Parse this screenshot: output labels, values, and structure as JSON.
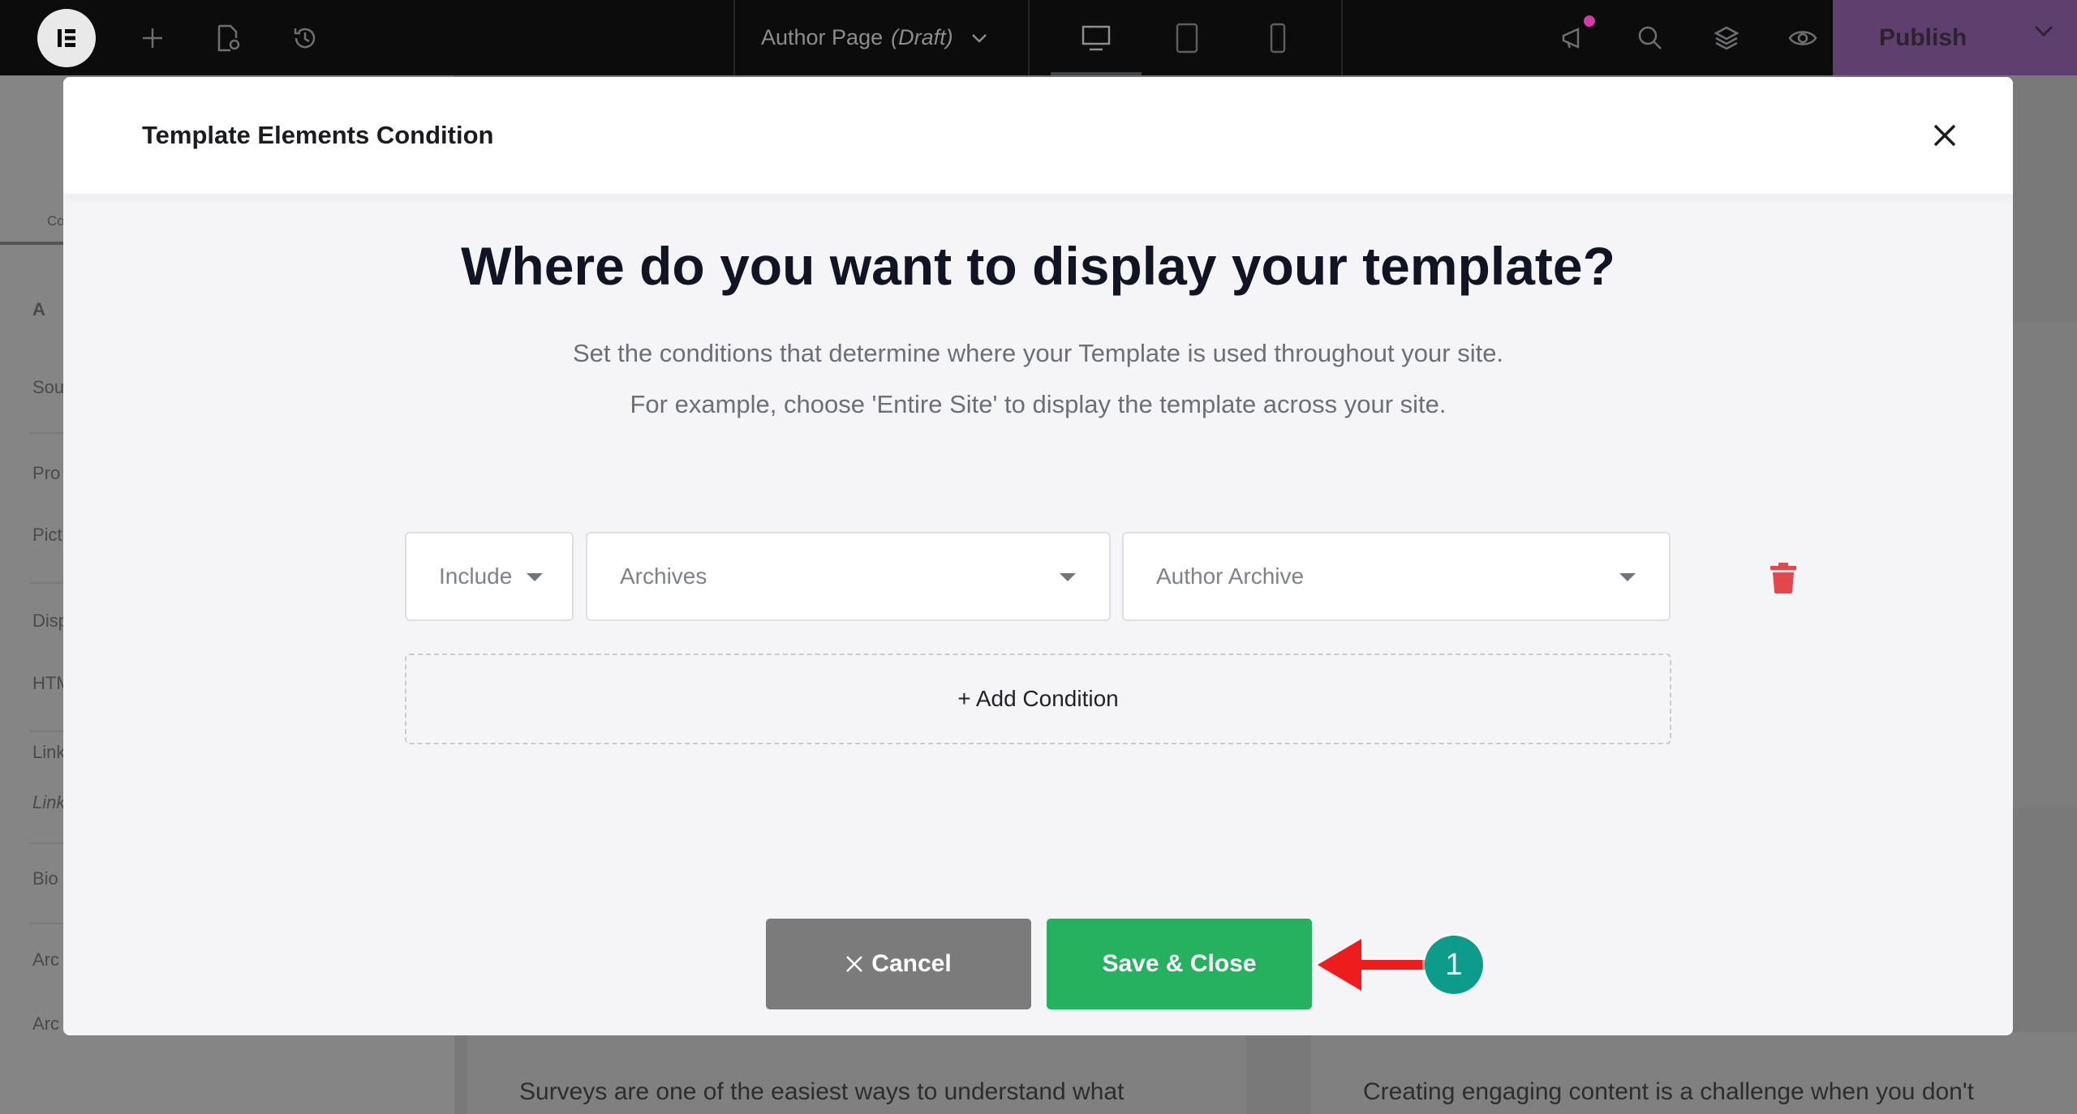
{
  "topbar": {
    "page_title": "Author Page",
    "page_status": "(Draft)",
    "publish_label": "Publish",
    "accent_color": "#5f3f6e"
  },
  "background": {
    "panel_rows": [
      "Co",
      "A",
      "Sou",
      "Pro",
      "Pict",
      "Disp",
      "HTM",
      "Link",
      "Link",
      "Bio",
      "Arc",
      "Arc"
    ],
    "card_text_left": "Surveys are one of the easiest ways to understand what",
    "card_text_right": "Creating engaging content is a challenge when you don't"
  },
  "modal": {
    "title": "Template Elements Condition",
    "headline": "Where do you want to display your template?",
    "description_1": "Set the conditions that determine where your Template is used throughout your site.",
    "description_2": "For example, choose 'Entire Site' to display the template across your site.",
    "condition": {
      "type": "Include",
      "group": "Archives",
      "target": "Author Archive"
    },
    "add_condition_label": "+ Add Condition",
    "cancel_label": "Cancel",
    "save_label": "Save & Close",
    "save_color": "#25b15e",
    "delete_color": "#e2484b"
  },
  "annotation": {
    "badge": "1",
    "arrow_color": "#ee1c1c"
  }
}
